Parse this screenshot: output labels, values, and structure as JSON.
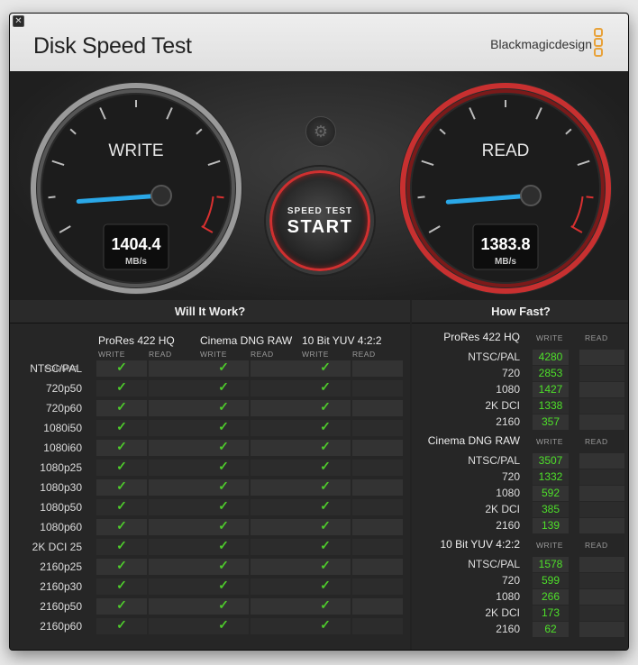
{
  "app": {
    "title": "Disk Speed Test",
    "brand": "Blackmagicdesign",
    "close_glyph": "✕"
  },
  "gauges": {
    "write": {
      "label": "WRITE",
      "value": "1404.4",
      "unit": "MB/s",
      "speed_mbps": 1404.4
    },
    "read": {
      "label": "READ",
      "value": "1383.8",
      "unit": "MB/s",
      "speed_mbps": 1383.8
    }
  },
  "controls": {
    "settings_icon": "gear-icon",
    "start_small": "SPEED TEST",
    "start_big": "START"
  },
  "will_it_work": {
    "title": "Will It Work?",
    "format_header": "FORMAT",
    "groups": [
      "ProRes 422 HQ",
      "Cinema DNG RAW",
      "10 Bit YUV 4:2:2"
    ],
    "write_label": "WRITE",
    "read_label": "READ",
    "formats": [
      "NTSC/PAL",
      "720p50",
      "720p60",
      "1080i50",
      "1080i60",
      "1080p25",
      "1080p30",
      "1080p50",
      "1080p60",
      "2K DCI 25",
      "2160p25",
      "2160p30",
      "2160p50",
      "2160p60"
    ],
    "check_glyph": "✓"
  },
  "how_fast": {
    "title": "How Fast?",
    "write_label": "WRITE",
    "read_label": "READ",
    "groups": [
      {
        "name": "ProRes 422 HQ",
        "rows": [
          {
            "format": "NTSC/PAL",
            "write": "4280"
          },
          {
            "format": "720",
            "write": "2853"
          },
          {
            "format": "1080",
            "write": "1427"
          },
          {
            "format": "2K DCI",
            "write": "1338"
          },
          {
            "format": "2160",
            "write": "357"
          }
        ]
      },
      {
        "name": "Cinema DNG RAW",
        "rows": [
          {
            "format": "NTSC/PAL",
            "write": "3507"
          },
          {
            "format": "720",
            "write": "1332"
          },
          {
            "format": "1080",
            "write": "592"
          },
          {
            "format": "2K DCI",
            "write": "385"
          },
          {
            "format": "2160",
            "write": "139"
          }
        ]
      },
      {
        "name": "10 Bit YUV 4:2:2",
        "rows": [
          {
            "format": "NTSC/PAL",
            "write": "1578"
          },
          {
            "format": "720",
            "write": "599"
          },
          {
            "format": "1080",
            "write": "266"
          },
          {
            "format": "2K DCI",
            "write": "173"
          },
          {
            "format": "2160",
            "write": "62"
          }
        ]
      }
    ]
  },
  "colors": {
    "accent_red": "#d83030",
    "needle_blue": "#2aa8e8",
    "check_green": "#4ec92c"
  }
}
